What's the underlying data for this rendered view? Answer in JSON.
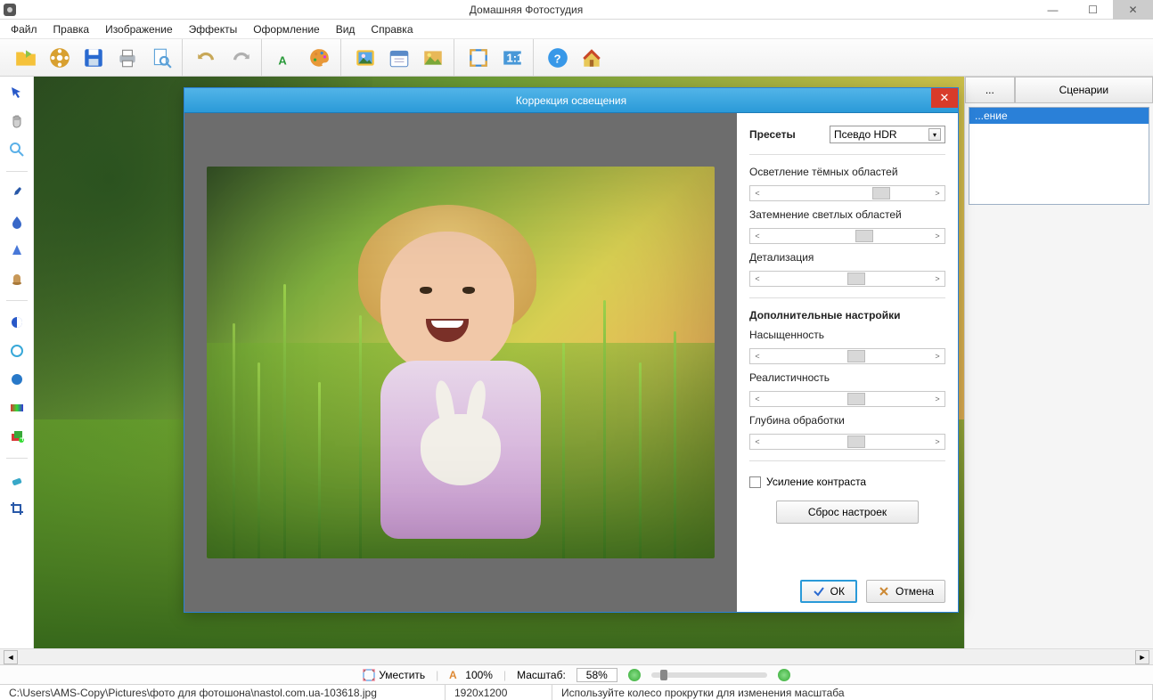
{
  "window": {
    "title": "Домашняя Фотостудия"
  },
  "menu": [
    "Файл",
    "Правка",
    "Изображение",
    "Эффекты",
    "Оформление",
    "Вид",
    "Справка"
  ],
  "right_panel": {
    "tabs": [
      "...",
      "Сценарии"
    ],
    "history_item": "...ение"
  },
  "zoombar": {
    "fit_label": "Уместить",
    "hundred_label": "100%",
    "scale_label": "Масштаб:",
    "scale_value": "58%"
  },
  "status": {
    "path": "C:\\Users\\AMS-Copy\\Pictures\\фото для фотошона\\nastol.com.ua-103618.jpg",
    "dimensions": "1920x1200",
    "hint": "Используйте колесо прокрутки для изменения масштаба"
  },
  "dialog": {
    "title": "Коррекция освещения",
    "presets_label": "Пресеты",
    "preset_value": "Псевдо HDR",
    "sliders": {
      "s1": "Осветление тёмных областей",
      "s2": "Затемнение светлых областей",
      "s3": "Детализация",
      "group2_title": "Дополнительные настройки",
      "s4": "Насыщенность",
      "s5": "Реалистичность",
      "s6": "Глубина обработки"
    },
    "enhance_contrast": "Усиление контраста",
    "reset_btn": "Сброс настроек",
    "ok": "ОК",
    "cancel": "Отмена"
  }
}
